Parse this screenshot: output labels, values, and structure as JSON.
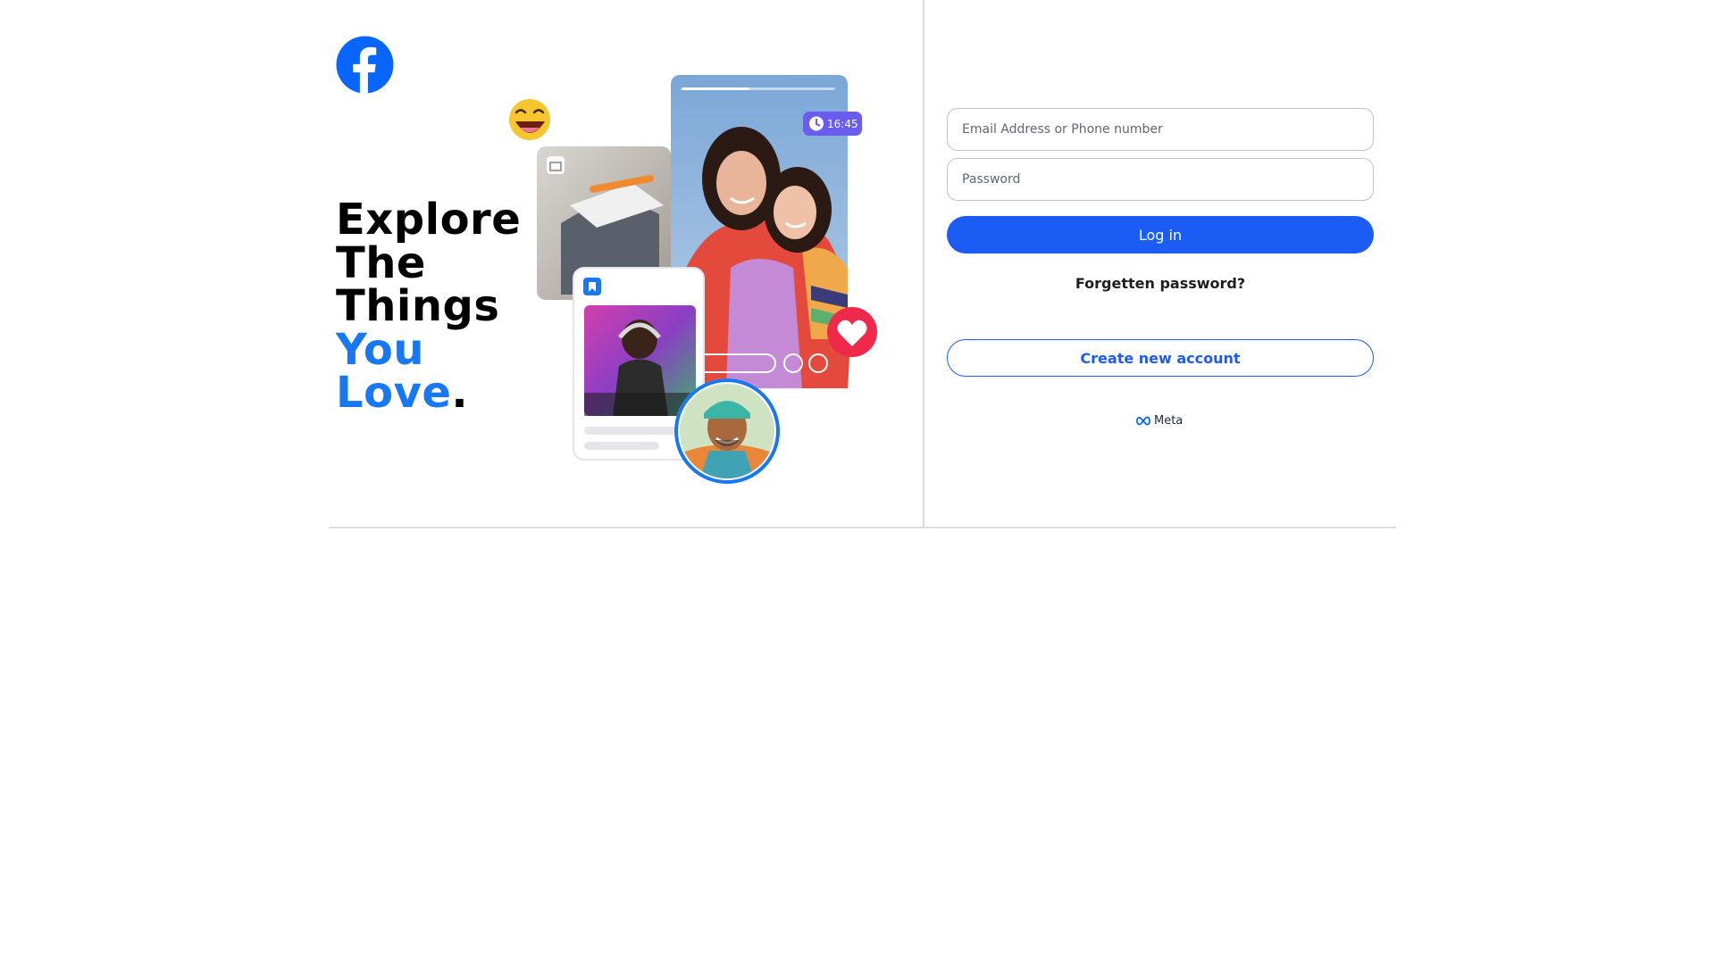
{
  "brand": {
    "logo_icon": "facebook-f-logo",
    "logo_color": "#1877f2",
    "accent_color": "#1877f2"
  },
  "headline": {
    "line1": "Explore",
    "line2": "The",
    "line3": "Things",
    "line4_accent": "You",
    "line5_accent": "Love",
    "period": "."
  },
  "hero": {
    "badge_time": "16:45",
    "icons": [
      "laughing-emoji-icon",
      "store-icon",
      "clock-icon",
      "heart-icon",
      "bookmark-icon"
    ]
  },
  "login": {
    "email_placeholder": "Email Address or Phone number",
    "email_value": "",
    "password_placeholder": "Password",
    "password_value": "",
    "login_label": "Log in",
    "forgot_label": "Forgetten password?",
    "create_label": "Create new account",
    "button_color": "#1b5cf5"
  },
  "footer": {
    "meta_label": "Meta",
    "meta_icon": "meta-infinity-icon"
  }
}
